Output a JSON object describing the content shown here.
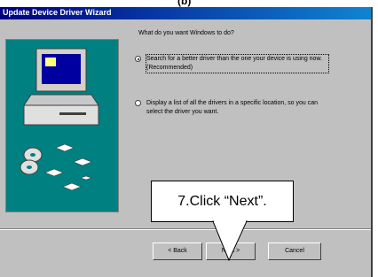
{
  "heading": "(b)",
  "window": {
    "title": "Update Device Driver Wizard"
  },
  "question": "What do you want Windows to do?",
  "options": [
    {
      "label": "Search for a better driver than the one your device is using now. (Recommended)",
      "selected": true
    },
    {
      "label": "Display a list of all the drivers in a specific location, so you can select the driver you want.",
      "selected": false
    }
  ],
  "buttons": {
    "back": "< Back",
    "next": "Next >",
    "cancel": "Cancel"
  },
  "callout": "7.Click “Next”."
}
